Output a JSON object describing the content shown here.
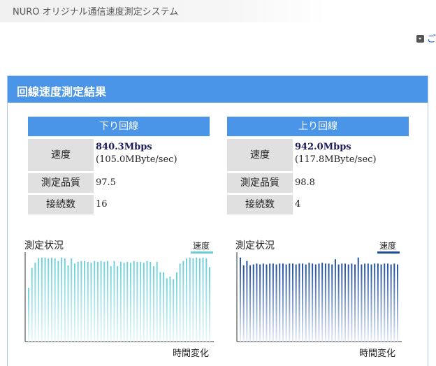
{
  "site": {
    "title": "NURO オリジナル通信速度測定システム",
    "corner_link": "ご"
  },
  "panel": {
    "title": "回線速度測定結果"
  },
  "down": {
    "header": "下り回線",
    "speed_label": "速度",
    "speed_value": "840.3Mbps",
    "speed_sub": "(105.0MByte/sec)",
    "quality_label": "測定品質",
    "quality_value": "97.5",
    "connections_label": "接続数",
    "connections_value": "16"
  },
  "up": {
    "header": "上り回線",
    "speed_label": "速度",
    "speed_value": "942.0Mbps",
    "speed_sub": "(117.8MByte/sec)",
    "quality_label": "測定品質",
    "quality_value": "98.8",
    "connections_label": "接続数",
    "connections_value": "4"
  },
  "colors": {
    "header_blue": "#4a95e8",
    "down_series": "#6ccfd8",
    "up_series": "#1f4e9c"
  },
  "chart_data": [
    {
      "type": "bar",
      "title": "測定状況",
      "xlabel": "時間変化",
      "ylabel": "",
      "series": [
        {
          "name": "速度",
          "values": [
            0.62,
            0.85,
            0.91,
            0.96,
            0.97,
            0.97,
            0.96,
            0.97,
            0.96,
            0.93,
            0.97,
            0.96,
            0.88,
            0.96,
            0.9,
            0.92,
            0.93,
            0.93,
            0.92,
            0.91,
            0.93,
            0.92,
            0.93,
            0.92,
            0.93,
            0.87,
            0.93,
            0.87,
            0.92,
            0.91,
            0.92,
            0.91,
            0.93,
            0.92,
            0.92,
            0.91,
            0.93,
            0.92,
            0.87,
            0.92,
            0.8,
            0.8,
            0.73,
            0.75,
            0.72,
            0.8,
            0.9,
            0.93,
            0.96,
            0.97,
            0.96,
            0.97,
            0.96,
            0.97,
            0.96,
            0.86
          ]
        }
      ],
      "ylim": [
        0,
        1
      ]
    },
    {
      "type": "bar",
      "title": "測定状況",
      "xlabel": "時間変化",
      "ylabel": "",
      "series": [
        {
          "name": "速度",
          "values": [
            0.97,
            0.88,
            0.93,
            0.88,
            0.89,
            0.9,
            0.89,
            0.9,
            0.89,
            0.9,
            0.9,
            0.89,
            0.9,
            0.9,
            0.89,
            0.9,
            0.9,
            0.89,
            0.9,
            0.9,
            0.89,
            0.91,
            0.9,
            0.89,
            0.9,
            0.91,
            0.9,
            0.9,
            0.89,
            0.95,
            0.89,
            0.9,
            0.9,
            0.89,
            0.9,
            0.89,
            0.97,
            0.89,
            0.9,
            0.9,
            0.89,
            0.9,
            0.9,
            0.89,
            0.9,
            0.9,
            0.89,
            0.9,
            0.89
          ]
        }
      ],
      "ylim": [
        0,
        1
      ]
    }
  ]
}
